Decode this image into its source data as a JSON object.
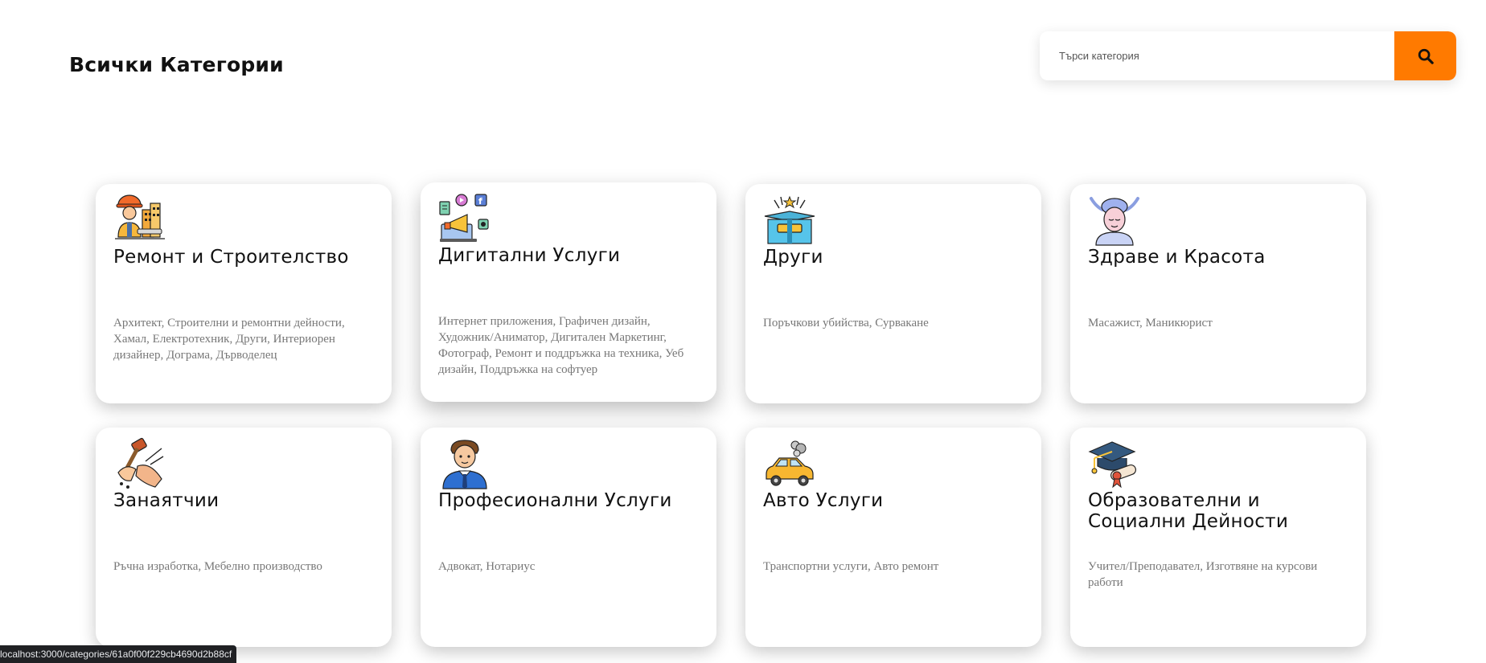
{
  "header": {
    "title": "Всички Категории"
  },
  "search": {
    "placeholder": "Търси категория",
    "button_icon": "search-icon"
  },
  "categories": [
    {
      "icon": "construction-worker-icon",
      "title": "Ремонт и Строителство",
      "description": "Архитект, Строителни и ремонтни дейности, Хамал, Електротехник, Други, Интериорен дизайнер, Дограма, Дърводелец"
    },
    {
      "icon": "digital-marketing-icon",
      "title": "Дигитални Услуги",
      "description": "Интернет приложения, Графичен дизайн, Художник/Аниматор, Дигитален Маркетинг, Фотограф, Ремонт и поддръжка на техника, Уеб дизайн, Поддръжка на софтуер"
    },
    {
      "icon": "gift-box-icon",
      "title": "Други",
      "description": "Поръчкови убийства, Сурвакане"
    },
    {
      "icon": "massage-icon",
      "title": "Здраве и Красота",
      "description": "Масажист, Маникюрист"
    },
    {
      "icon": "handcraft-hammer-icon",
      "title": "Занаятчии",
      "description": "Ръчна изработка, Мебелно производство"
    },
    {
      "icon": "businessman-icon",
      "title": "Професионални Услуги",
      "description": "Адвокат, Нотариус"
    },
    {
      "icon": "car-icon",
      "title": "Авто Услуги",
      "description": "Транспортни услуги, Авто ремонт"
    },
    {
      "icon": "graduation-cap-icon",
      "title": "Образователни и Социални Дейности",
      "description": "Учител/Преподавател, Изготвяне на курсови работи"
    }
  ],
  "status_bar": {
    "url": "localhost:3000/categories/61a0f00f229cb4690d2b88cf"
  },
  "colors": {
    "accent": "#ff7a00",
    "title_text": "#111111",
    "description_text": "#777777"
  }
}
